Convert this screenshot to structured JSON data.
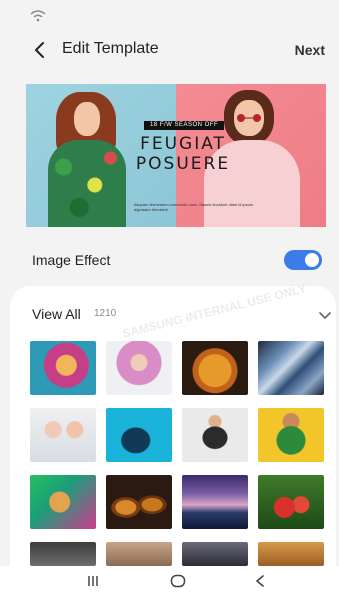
{
  "header": {
    "title": "Edit Template",
    "next_label": "Next"
  },
  "banner": {
    "season_tag": "18 F/W SEASON OFF",
    "headline_line1": "FEUGIAT",
    "headline_line2": "POSUERE",
    "subtext": "Aliquam fermentum commodo nunc. Mauris tincidunt diam id ipsum dignissim hendrerit."
  },
  "image_effect": {
    "label": "Image Effect",
    "enabled": true
  },
  "gallery": {
    "view_all_label": "View All",
    "count": "1210",
    "watermark": "SAMSUNG INTERNAL USE ONLY"
  },
  "colors": {
    "accent": "#3d7ce8",
    "background": "#f3f3f3",
    "sheet": "#ffffff"
  },
  "icons": [
    "wifi-icon",
    "back-arrow-icon",
    "chevron-down-icon",
    "recent-apps-icon",
    "home-icon",
    "nav-back-icon"
  ]
}
